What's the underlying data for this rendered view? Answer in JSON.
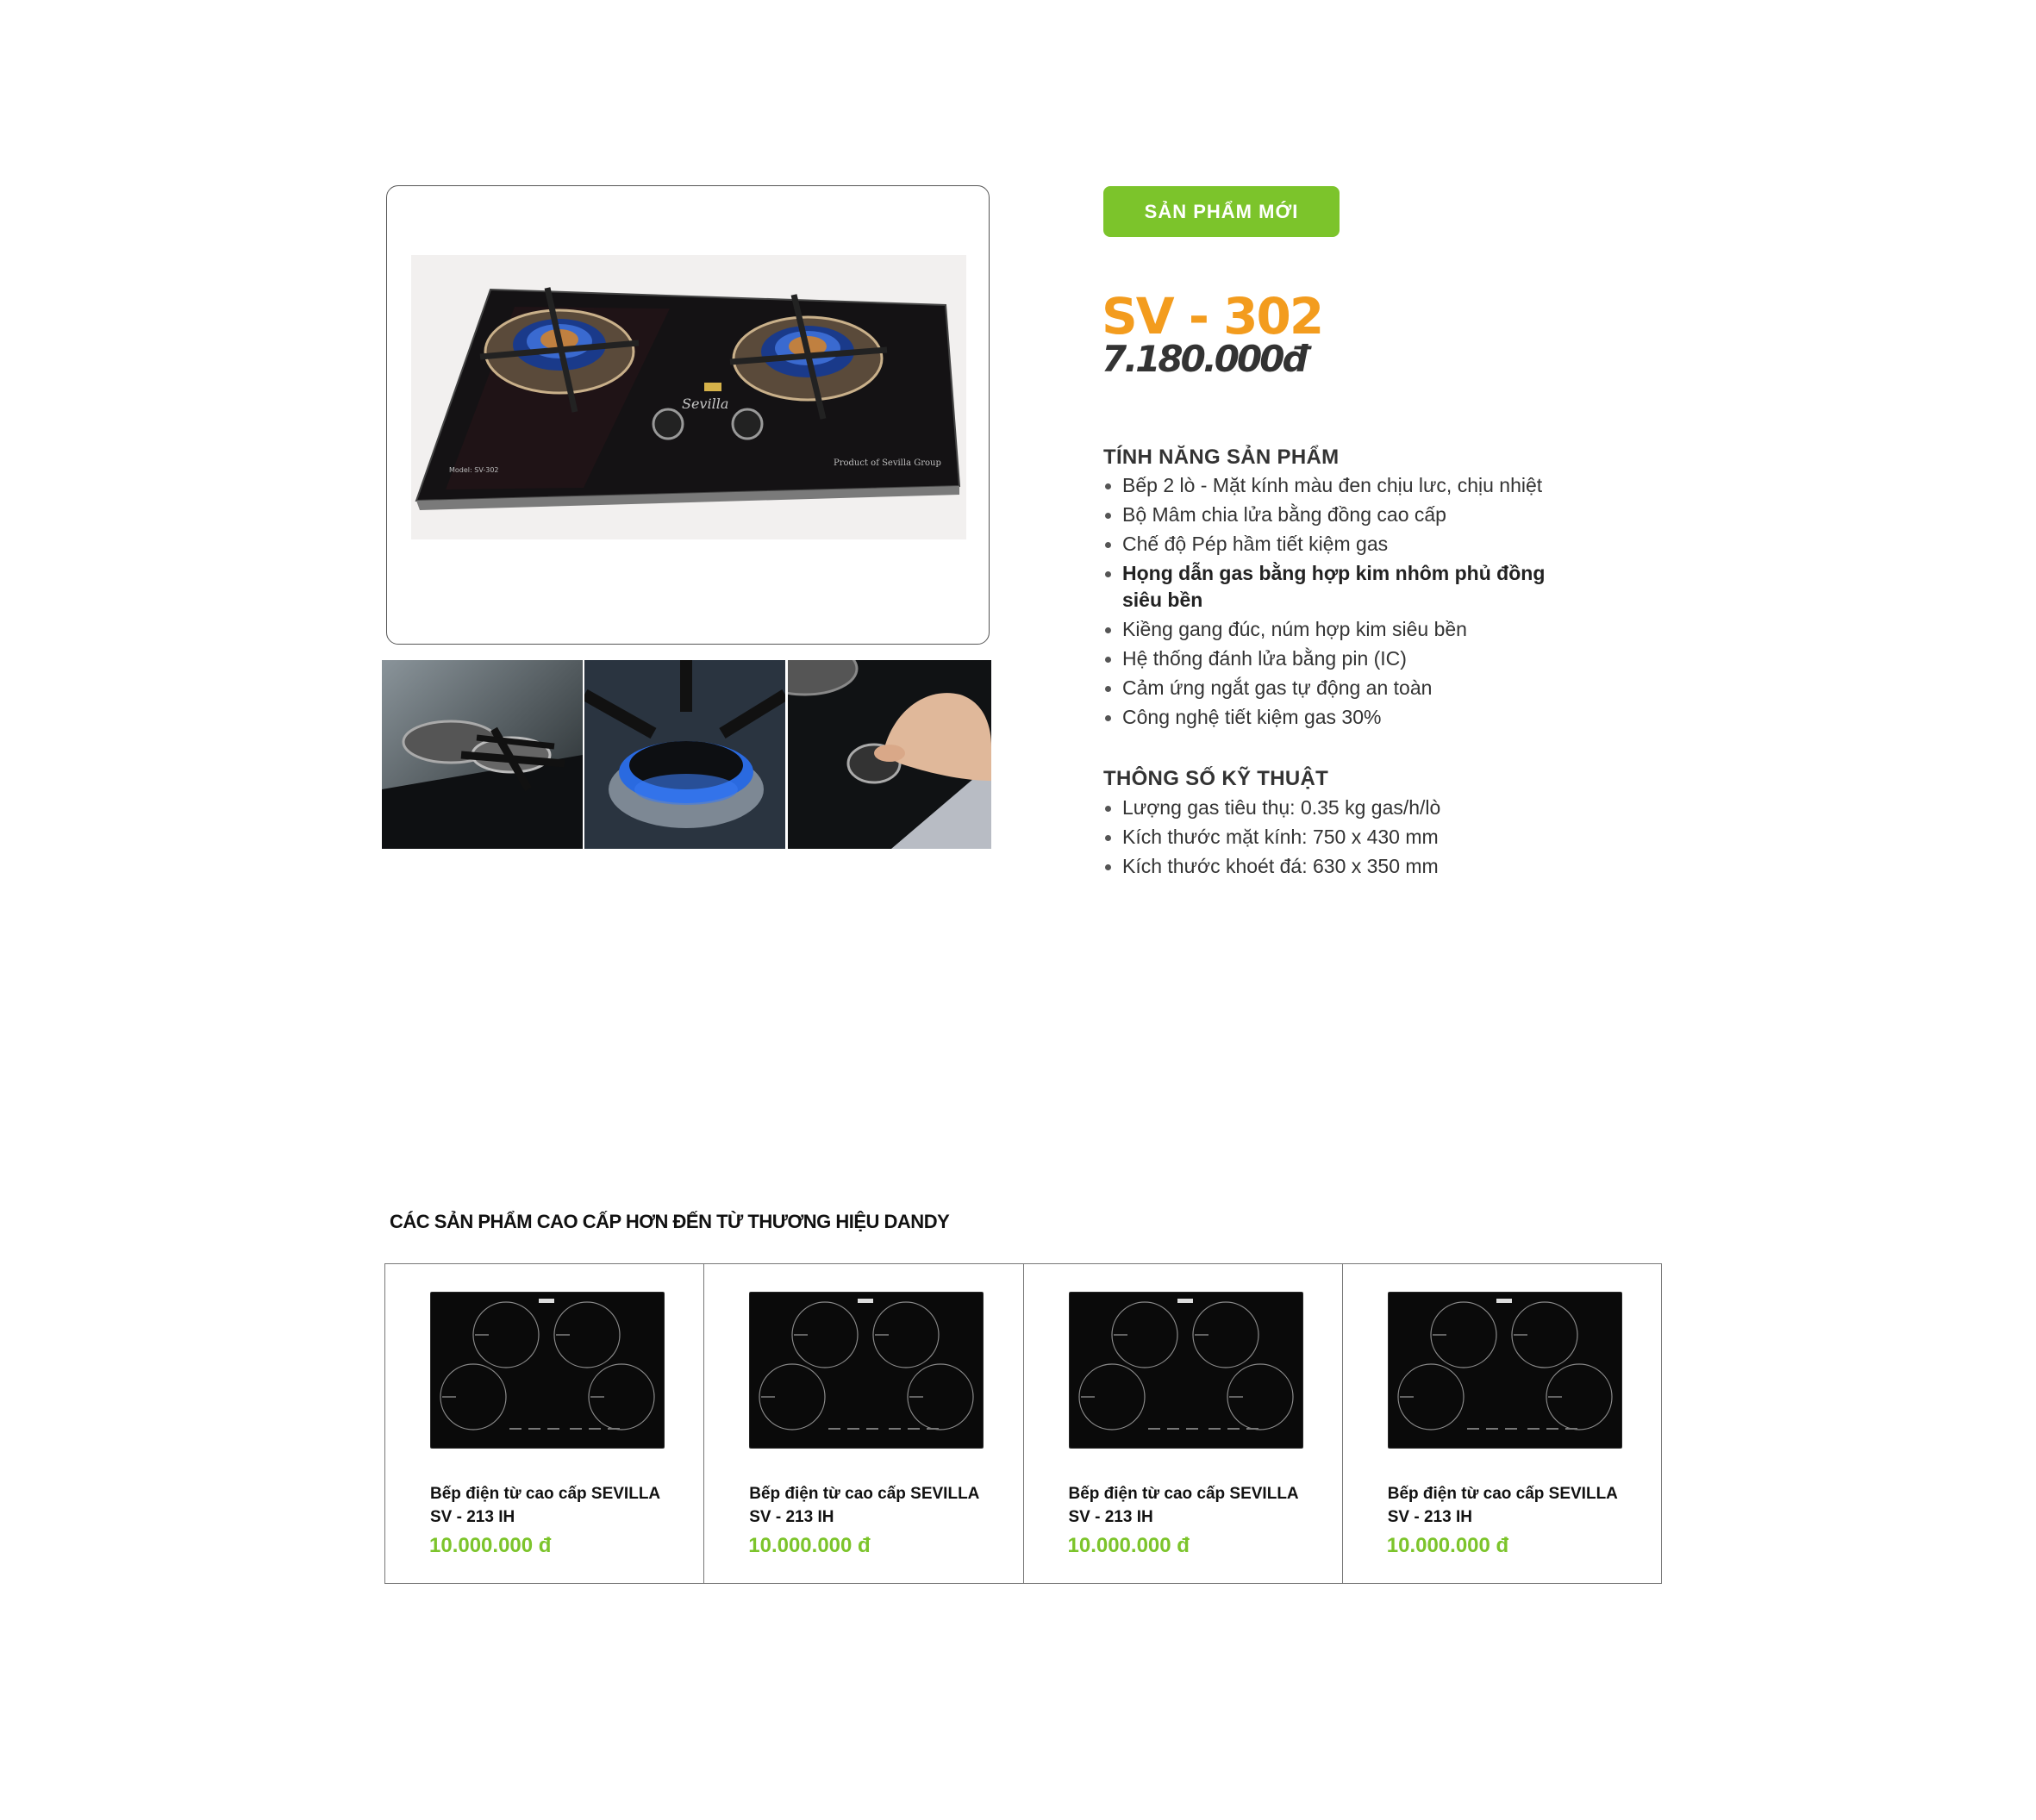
{
  "product": {
    "badge": "SẢN PHẨM MỚI",
    "model": "SV - 302",
    "price": "7.180.000đ",
    "image_text": {
      "brand": "Sevilla",
      "model_label": "Model: SV-302",
      "origin": "Product of Sevilla Group"
    }
  },
  "features": {
    "title": "TÍNH NĂNG SẢN PHẨM",
    "items": [
      "Bếp 2 lò - Mặt kính màu đen chịu lưc, chịu nhiệt",
      "Bộ Mâm chia lửa bằng đồng cao cấp",
      "Chế độ Pép hầm tiết kiệm gas",
      "Họng dẫn gas bằng hợp kim nhôm phủ đồng siêu bền",
      "Kiềng gang đúc, núm hợp kim siêu bền",
      "Hệ thống đánh lửa bằng pin (IC)",
      "Cảm ứng ngắt gas tự động an toàn",
      "Công nghệ tiết kiệm gas 30%"
    ]
  },
  "specs": {
    "title": "THÔNG SỐ KỸ THUẬT",
    "items": [
      "Lượng gas tiêu thụ: 0.35 kg gas/h/lò",
      "Kích thước mặt kính: 750 x 430 mm",
      "Kích thước khoét đá: 630 x 350 mm"
    ]
  },
  "related": {
    "title": "CÁC SẢN PHẨM CAO CẤP HƠN ĐẾN TỪ THƯƠNG HIỆU DANDY",
    "items": [
      {
        "name": "Bếp điện từ cao cấp SEVILLA SV - 213 IH",
        "price": "10.000.000 đ"
      },
      {
        "name": "Bếp điện từ cao cấp SEVILLA SV - 213 IH",
        "price": "10.000.000 đ"
      },
      {
        "name": "Bếp điện từ cao cấp SEVILLA SV - 213 IH",
        "price": "10.000.000 đ"
      },
      {
        "name": "Bếp điện từ cao cấp SEVILLA SV - 213 IH",
        "price": "10.000.000 đ"
      }
    ]
  },
  "colors": {
    "accent_green": "#7cc42b",
    "model_orange": "#f39c1e",
    "text_dark": "#333333"
  }
}
